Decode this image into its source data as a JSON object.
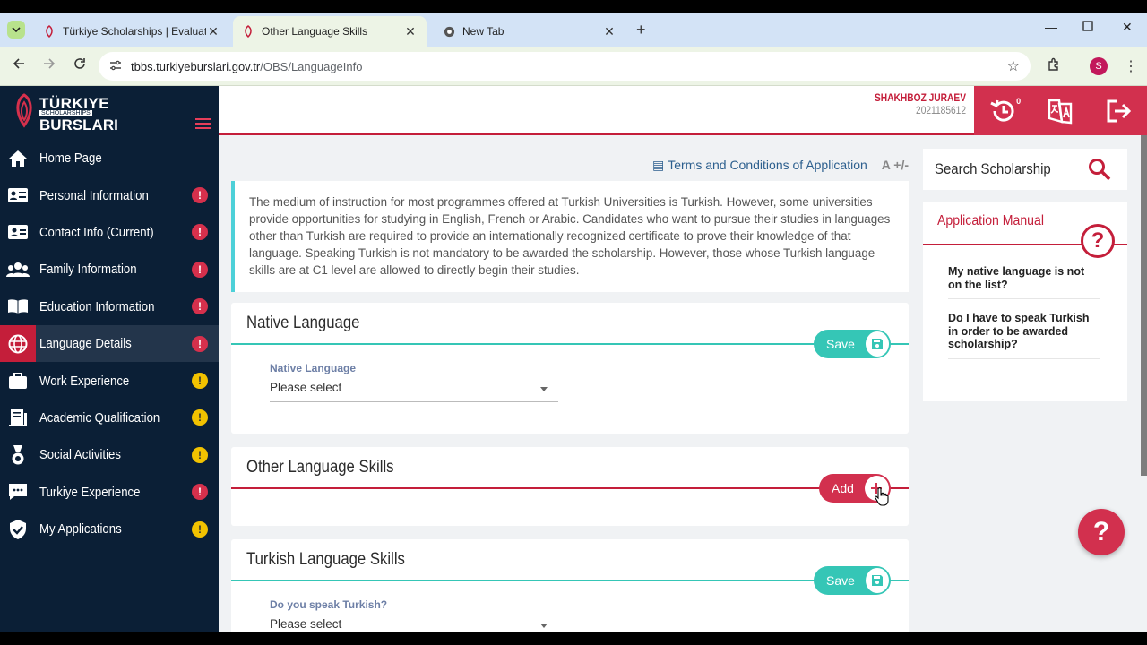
{
  "browser": {
    "tabs": [
      {
        "title": "Türkiye Scholarships | Evaluatio",
        "icon": "tulip-icon"
      },
      {
        "title": "Other Language Skills",
        "icon": "tulip-icon"
      },
      {
        "title": "New Tab",
        "icon": "chrome-icon"
      }
    ],
    "url_host": "tbbs.turkiyeburslari.gov.tr",
    "url_path": "/OBS/LanguageInfo",
    "profile_initial": "S"
  },
  "brand": {
    "line1": "TÜRKIYE",
    "line2": "SCHOLARSHIPS",
    "line3": "BURSLARI"
  },
  "sidebar": {
    "items": [
      {
        "label": "Home Page",
        "icon": "home-icon",
        "badge": ""
      },
      {
        "label": "Personal Information",
        "icon": "id-card-icon",
        "badge": "!"
      },
      {
        "label": "Contact Info (Current)",
        "icon": "contact-card-icon",
        "badge": "!"
      },
      {
        "label": "Family Information",
        "icon": "family-icon",
        "badge": "!"
      },
      {
        "label": "Education Information",
        "icon": "book-icon",
        "badge": "!"
      },
      {
        "label": "Language Details",
        "icon": "globe-icon",
        "badge": "!"
      },
      {
        "label": "Work Experience",
        "icon": "briefcase-icon",
        "badge": "!"
      },
      {
        "label": "Academic Qualification",
        "icon": "certificate-icon",
        "badge": "!"
      },
      {
        "label": "Social Activities",
        "icon": "medal-icon",
        "badge": "!"
      },
      {
        "label": "Turkiye Experience",
        "icon": "chat-icon",
        "badge": "!"
      },
      {
        "label": "My Applications",
        "icon": "shield-check-icon",
        "badge": "!"
      }
    ]
  },
  "user": {
    "name": "SHAKHBOZ JURAEV",
    "id": "2021185612",
    "notifications": "0"
  },
  "toolbar": {
    "terms": "Terms and Conditions of Application",
    "font_size": "A +/-"
  },
  "info_text": "The medium of instruction for most programmes offered at Turkish Universities is Turkish. However, some universities provide opportunities for studying in English, French or Arabic. Candidates who want to pursue their studies in languages other than Turkish are required to provide an internationally recognized certificate to prove their knowledge of that language. Speaking Turkish is not mandatory to be awarded the scholarship. However, those whose Turkish language skills are at C1 level are allowed to directly begin their studies.",
  "native": {
    "title": "Native Language",
    "save_label": "Save",
    "field_label": "Native Language",
    "field_value": "Please select"
  },
  "other": {
    "title": "Other Language Skills",
    "add_label": "Add"
  },
  "turkish": {
    "title": "Turkish Language Skills",
    "save_label": "Save",
    "field_label": "Do you speak Turkish?",
    "field_value": "Please select"
  },
  "search": {
    "label": "Search Scholarship"
  },
  "manual": {
    "title": "Application Manual",
    "faqs": [
      "My native language is not on the list?",
      "Do I have to speak Turkish in order to be awarded scholarship?"
    ]
  },
  "help": "?",
  "colors": {
    "brand_red": "#c41e3a",
    "teal": "#35c6b6",
    "sidebar_bg": "#0b1f36",
    "badge_red": "#d6304c",
    "badge_yellow": "#f2c200"
  }
}
